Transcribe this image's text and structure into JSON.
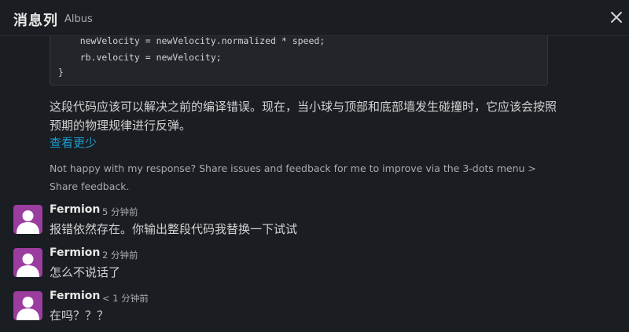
{
  "header": {
    "title": "消息列",
    "subtitle": "Albus"
  },
  "code": {
    "lines": [
      "    newVelocity = newVelocity.normalized * speed;",
      "    rb.velocity = newVelocity;",
      "}"
    ]
  },
  "reply": {
    "text": "这段代码应该可以解决之前的编译错误。现在，当小球与顶部和底部墙发生碰撞时，它应该会按照预期的物理规律进行反弹。",
    "see_more": "查看更少",
    "feedback": "Not happy with my response? Share issues and feedback for me to improve via the 3-dots menu > Share feedback."
  },
  "messages": [
    {
      "author": "Fermion",
      "time": "5 分钟前",
      "text": "报错依然存在。你输出整段代码我替换一下试试"
    },
    {
      "author": "Fermion",
      "time": "2 分钟前",
      "text": "怎么不说话了"
    },
    {
      "author": "Fermion",
      "time": "< 1 分钟前",
      "text": "在吗？？？"
    }
  ],
  "colors": {
    "background": "#1a1d21",
    "avatar": "#9b3c9f",
    "link": "#1d9bd1"
  },
  "icons": {
    "close": "close-icon",
    "avatar": "user-avatar-icon"
  }
}
